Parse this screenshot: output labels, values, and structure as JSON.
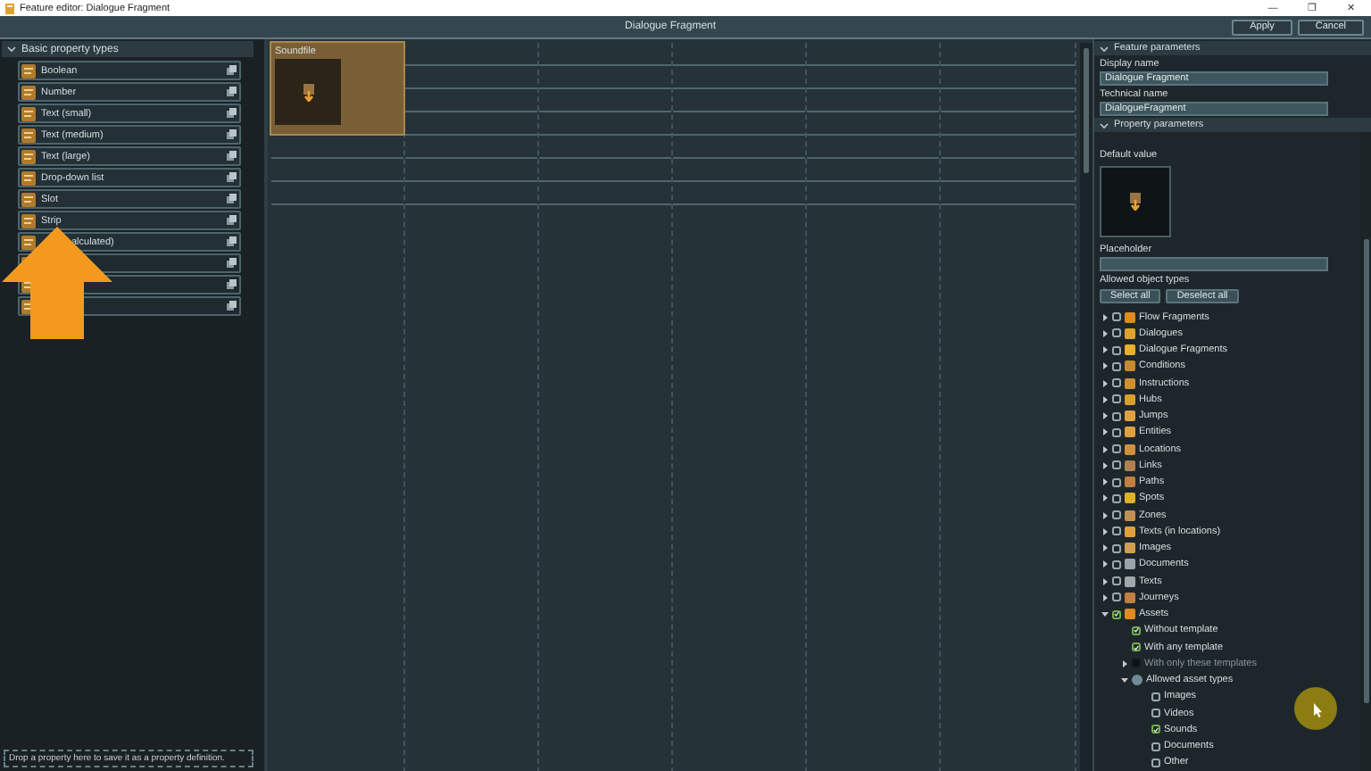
{
  "window": {
    "title": "Feature editor: Dialogue Fragment",
    "controls": [
      "—",
      "❐",
      "✕"
    ]
  },
  "header": {
    "title": "Dialogue Fragment",
    "buttons": [
      "Apply",
      "Cancel"
    ]
  },
  "property_types": {
    "title": "Basic property types",
    "expanded": true,
    "items": [
      {
        "kind": "property",
        "label": "Boolean"
      },
      {
        "kind": "property",
        "label": "Number"
      },
      {
        "kind": "property",
        "label": "Text (small)"
      },
      {
        "kind": "property",
        "label": "Text (medium)"
      },
      {
        "kind": "property",
        "label": "Text (large)"
      },
      {
        "kind": "property",
        "label": "Drop-down list"
      },
      {
        "kind": "property",
        "label": "Slot"
      },
      {
        "kind": "property",
        "label": "Strip"
      },
      {
        "kind": "partial",
        "label": "alculated)"
      },
      {
        "kind": "covered"
      },
      {
        "kind": "covered"
      },
      {
        "kind": "covered"
      }
    ],
    "hint": "Drop a property here to save it as a property definition."
  },
  "canvas": {
    "cells": [
      {
        "label": "Soundfile",
        "selected": true
      }
    ]
  },
  "feature_parameters": {
    "title": "Feature parameters",
    "fields": [
      {
        "label": "Display name",
        "value": "Dialogue Fragment"
      },
      {
        "label": "Technical name",
        "value": "DialogueFragment"
      }
    ]
  },
  "property_parameters": {
    "title": "Property parameters",
    "default_label": "Default value",
    "placeholder_label": "Placeholder",
    "allowed_label": "Allowed object types",
    "buttons": [
      "Select all",
      "Deselect all"
    ],
    "tree": [
      {
        "label": "Flow Fragments",
        "checked": false,
        "expanded": false
      },
      {
        "label": "Dialogues",
        "checked": false,
        "expanded": false
      },
      {
        "label": "Dialogue Fragments",
        "checked": false,
        "expanded": false
      },
      {
        "label": "Conditions",
        "checked": false,
        "expanded": false
      },
      {
        "label": "Instructions",
        "checked": false,
        "expanded": false
      },
      {
        "label": "Hubs",
        "checked": false,
        "expanded": false
      },
      {
        "label": "Jumps",
        "checked": false,
        "expanded": false
      },
      {
        "label": "Entities",
        "checked": false,
        "expanded": false
      },
      {
        "label": "Locations",
        "checked": false,
        "expanded": false
      },
      {
        "label": "Links",
        "checked": false,
        "expanded": false
      },
      {
        "label": "Paths",
        "checked": false,
        "expanded": false
      },
      {
        "label": "Spots",
        "checked": false,
        "expanded": false
      },
      {
        "label": "Zones",
        "checked": false,
        "expanded": false
      },
      {
        "label": "Texts (in locations)",
        "checked": false,
        "expanded": false
      },
      {
        "label": "Images",
        "checked": false,
        "expanded": false
      },
      {
        "label": "Documents",
        "checked": false,
        "expanded": false
      },
      {
        "label": "Texts",
        "checked": false,
        "expanded": false
      },
      {
        "label": "Journeys",
        "checked": false,
        "expanded": false
      },
      {
        "label": "Assets",
        "checked": true,
        "expanded": true,
        "children": [
          {
            "label": "Without template",
            "checked": true
          },
          {
            "label": "With any template",
            "checked": true
          },
          {
            "label": "With only these templates",
            "checked": false,
            "disabled": true,
            "expanded": false
          },
          {
            "label": "Allowed asset types",
            "kind": "group",
            "expanded": true,
            "children": [
              {
                "label": "Images",
                "checked": false
              },
              {
                "label": "Videos",
                "checked": false
              },
              {
                "label": "Sounds",
                "checked": true
              },
              {
                "label": "Documents",
                "checked": false
              },
              {
                "label": "Other",
                "checked": false
              }
            ]
          }
        ]
      }
    ]
  }
}
